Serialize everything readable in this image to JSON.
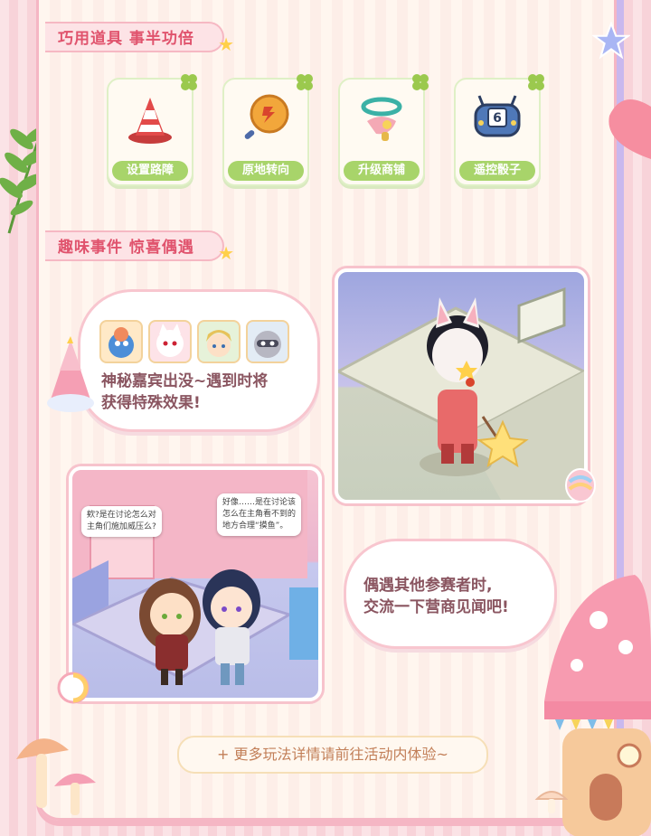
{
  "sections": {
    "tools_title": "巧用道具 事半功倍",
    "events_title": "趣味事件 惊喜偶遇"
  },
  "tools": [
    {
      "label": "设置路障",
      "icon": "traffic-cone-icon"
    },
    {
      "label": "原地转向",
      "icon": "turn-around-icon"
    },
    {
      "label": "升级商铺",
      "icon": "upgrade-shop-icon"
    },
    {
      "label": "遥控骰子",
      "icon": "remote-dice-icon"
    }
  ],
  "events": {
    "guest_text_line1": "神秘嘉宾出没~遇到时将",
    "guest_text_line2": "获得特殊效果!",
    "encounter_text_line1": "偶遇其他参赛者时,",
    "encounter_text_line2": "交流一下营商见闻吧!",
    "dice_face": "6",
    "speech_left_line1": "欸?是在讨论怎么对",
    "speech_left_line2": "主角们施加威压么?",
    "speech_right_line1": "好像……是在讨论该",
    "speech_right_line2": "怎么在主角看不到的",
    "speech_right_line3": "地方合理“摸鱼”。"
  },
  "footer": {
    "text": "+ 更多玩法详情请前往活动内体验~"
  },
  "colors": {
    "accent": "#e0536d",
    "tool_label_bg": "#a8d46a",
    "bubble_border": "#f8c6cf",
    "footer_text": "#c27f58"
  }
}
